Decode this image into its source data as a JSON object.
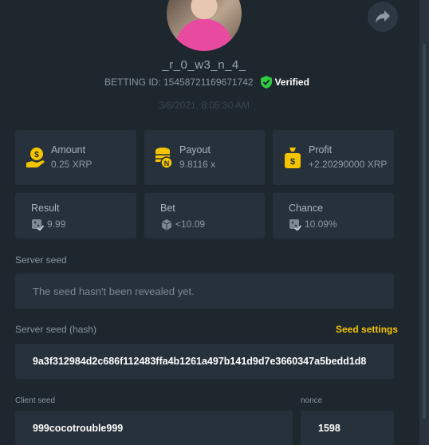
{
  "profile": {
    "username": "_r_0_w3_n_4_",
    "betting_id": "BETTING ID: 15458721169671742",
    "verified_label": "Verified",
    "timestamp": "3/8/2021, 8:05:30 AM"
  },
  "stats_top": [
    {
      "label": "Amount",
      "value": "0.25 XRP",
      "icon": "coin-hand-icon"
    },
    {
      "label": "Payout",
      "value": "9.8116 x",
      "icon": "coin-stack-icon"
    },
    {
      "label": "Profit",
      "value": "+2.20290000 XRP",
      "icon": "money-bag-icon"
    }
  ],
  "stats_bottom": [
    {
      "label": "Result",
      "value": "9.99",
      "icon": "dice-check-icon"
    },
    {
      "label": "Bet",
      "value": "<10.09",
      "icon": "dice-icon"
    },
    {
      "label": "Chance",
      "value": "10.09%",
      "icon": "dice-check-icon"
    }
  ],
  "server_seed": {
    "label": "Server seed",
    "value": "The seed hasn't been revealed yet."
  },
  "server_seed_hash": {
    "label": "Server seed (hash)",
    "settings_link": "Seed settings",
    "value": "9a3f312984d2c686f112483ffa4b1261a497b141d9d7e3660347a5bedd1d8"
  },
  "client_seed": {
    "label": "Client seed",
    "value": "999cocotrouble999"
  },
  "nonce": {
    "label": "nonce",
    "value": "1598"
  },
  "colors": {
    "background": "#1e262e",
    "card": "#27313b",
    "accent_yellow": "#f5c400",
    "verified_green": "#2ecc40"
  }
}
